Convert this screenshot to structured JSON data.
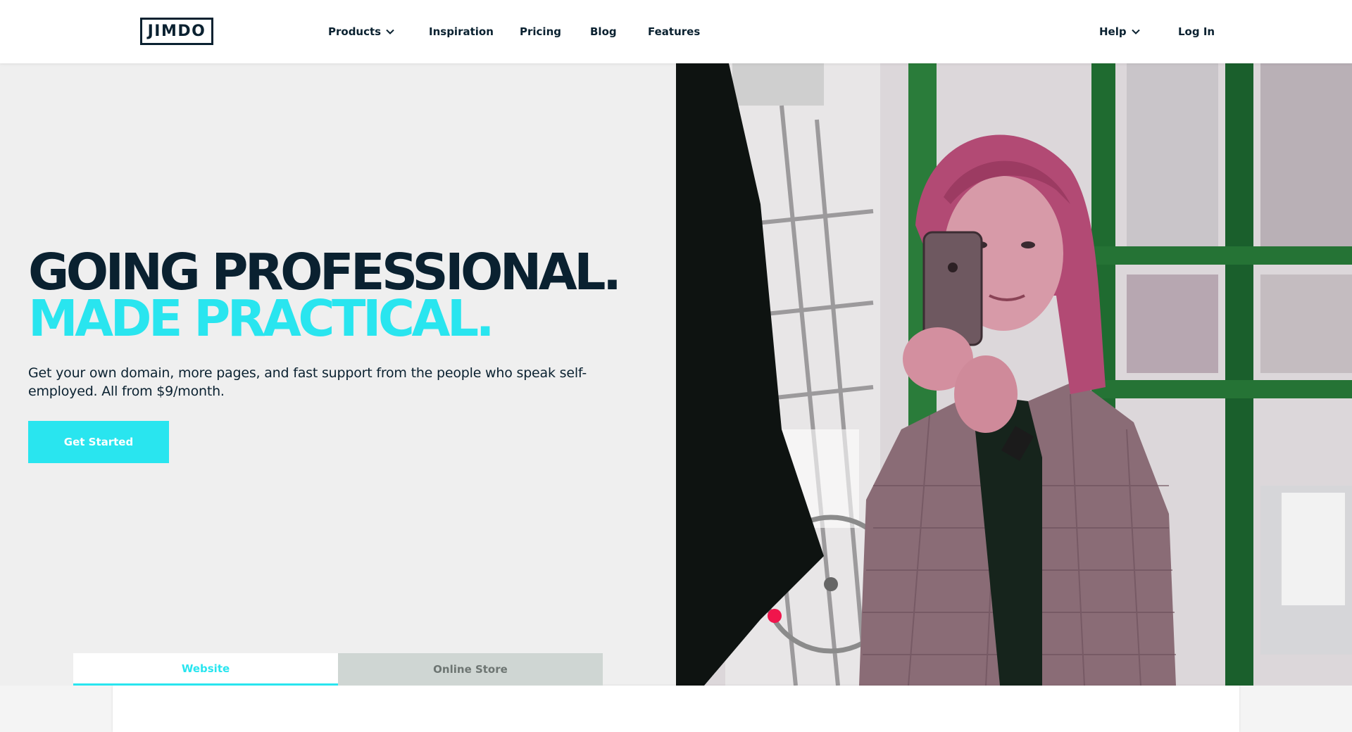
{
  "header": {
    "logo_text": "JIMDO",
    "nav": [
      {
        "label": "Products",
        "has_dropdown": true
      },
      {
        "label": "Inspiration",
        "has_dropdown": false
      },
      {
        "label": "Pricing",
        "has_dropdown": false
      },
      {
        "label": "Blog",
        "has_dropdown": false
      },
      {
        "label": "Features",
        "has_dropdown": false
      }
    ],
    "right_nav": [
      {
        "label": "Help",
        "has_dropdown": true
      },
      {
        "label": "Log In",
        "has_dropdown": false
      }
    ]
  },
  "hero": {
    "headline_line1": "GOING PROFESSIONAL.",
    "headline_line2": "MADE PRACTICAL.",
    "subtext": "Get your own domain, more pages, and fast support from the people who speak self-employed. All from $9/month.",
    "cta_label": "Get Started",
    "image_alt": "Woman taking a photo with a smartphone in a shop doorway"
  },
  "tabs": [
    {
      "label": "Website",
      "active": true
    },
    {
      "label": "Online Store",
      "active": false
    }
  ],
  "colors": {
    "navy": "#0a2130",
    "accent_cyan": "#29e5ef",
    "hero_bg": "#efefef",
    "tab_inactive_bg": "#cfd6d3"
  },
  "icons": {
    "dropdown": "chevron-down-icon"
  }
}
